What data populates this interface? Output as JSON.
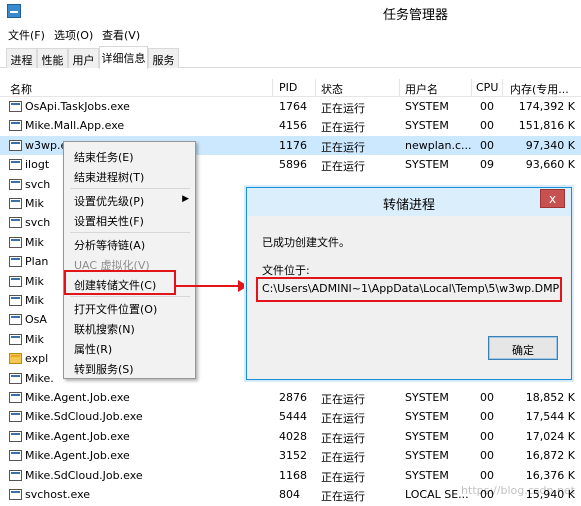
{
  "window": {
    "title": "任务管理器"
  },
  "menu": [
    "文件(F)",
    "选项(O)",
    "查看(V)"
  ],
  "tabs": [
    "进程",
    "性能",
    "用户",
    "详细信息",
    "服务"
  ],
  "columns": {
    "name": "名称",
    "pid": "PID",
    "status": "状态",
    "user": "用户名",
    "cpu": "CPU",
    "mem": "内存(专用..."
  },
  "rows": [
    {
      "name": "OsApi.TaskJobs.exe",
      "pid": "1764",
      "status": "正在运行",
      "user": "SYSTEM",
      "cpu": "00",
      "mem": "174,392 K"
    },
    {
      "name": "Mike.Mall.App.exe",
      "pid": "4156",
      "status": "正在运行",
      "user": "SYSTEM",
      "cpu": "00",
      "mem": "151,816 K"
    },
    {
      "name": "w3wp.exe",
      "pid": "1176",
      "status": "正在运行",
      "user": "newplan.c...",
      "cpu": "00",
      "mem": "97,340 K"
    },
    {
      "name": "ilogt",
      "pid": "5896",
      "status": "正在运行",
      "user": "SYSTEM",
      "cpu": "09",
      "mem": "93,660 K"
    },
    {
      "name": "svch",
      "pid": "",
      "status": "",
      "user": "",
      "cpu": "",
      "mem": ""
    },
    {
      "name": "Mik",
      "pid": "",
      "status": "",
      "user": "",
      "cpu": "",
      "mem": ""
    },
    {
      "name": "svch",
      "pid": "",
      "status": "",
      "user": "",
      "cpu": "",
      "mem": ""
    },
    {
      "name": "Mik",
      "pid": "",
      "status": "",
      "user": "",
      "cpu": "",
      "mem": ""
    },
    {
      "name": "Plan",
      "pid": "",
      "status": "",
      "user": "",
      "cpu": "",
      "mem": ""
    },
    {
      "name": "Mik",
      "pid": "",
      "status": "",
      "user": "",
      "cpu": "",
      "mem": ""
    },
    {
      "name": "Mik",
      "pid": "",
      "status": "",
      "user": "",
      "cpu": "",
      "mem": ""
    },
    {
      "name": "OsA",
      "pid": "",
      "status": "",
      "user": "",
      "cpu": "",
      "mem": ""
    },
    {
      "name": "Mik",
      "pid": "",
      "status": "",
      "user": "",
      "cpu": "",
      "mem": ""
    },
    {
      "name": "expl",
      "pid": "",
      "status": "",
      "user": "",
      "cpu": "",
      "mem": ""
    },
    {
      "name": "Mike.",
      "pid": "",
      "status": "",
      "user": "",
      "cpu": "",
      "mem": ""
    },
    {
      "name": "Mike.Agent.Job.exe",
      "pid": "2876",
      "status": "正在运行",
      "user": "SYSTEM",
      "cpu": "00",
      "mem": "18,852 K"
    },
    {
      "name": "Mike.SdCloud.Job.exe",
      "pid": "5444",
      "status": "正在运行",
      "user": "SYSTEM",
      "cpu": "00",
      "mem": "17,544 K"
    },
    {
      "name": "Mike.Agent.Job.exe",
      "pid": "4028",
      "status": "正在运行",
      "user": "SYSTEM",
      "cpu": "00",
      "mem": "17,024 K"
    },
    {
      "name": "Mike.Agent.Job.exe",
      "pid": "3152",
      "status": "正在运行",
      "user": "SYSTEM",
      "cpu": "00",
      "mem": "16,872 K"
    },
    {
      "name": "Mike.SdCloud.Job.exe",
      "pid": "1168",
      "status": "正在运行",
      "user": "SYSTEM",
      "cpu": "00",
      "mem": "16,376 K"
    },
    {
      "name": "svchost.exe",
      "pid": "804",
      "status": "正在运行",
      "user": "LOCAL SE...",
      "cpu": "00",
      "mem": "15,940 K"
    }
  ],
  "context_menu": {
    "items": [
      {
        "label": "结束任务(E)",
        "enabled": true
      },
      {
        "label": "结束进程树(T)",
        "enabled": true
      },
      {
        "label": "设置优先级(P)",
        "enabled": true,
        "submenu": true
      },
      {
        "label": "设置相关性(F)",
        "enabled": true
      },
      {
        "label": "分析等待链(A)",
        "enabled": true
      },
      {
        "label": "UAC 虚拟化(V)",
        "enabled": false
      },
      {
        "label": "创建转储文件(C)",
        "enabled": true
      },
      {
        "label": "打开文件位置(O)",
        "enabled": true
      },
      {
        "label": "联机搜索(N)",
        "enabled": true
      },
      {
        "label": "属性(R)",
        "enabled": true
      },
      {
        "label": "转到服务(S)",
        "enabled": true
      }
    ]
  },
  "dialog": {
    "title": "转储进程",
    "close_label": "x",
    "message": "已成功创建文件。",
    "location_label": "文件位于:",
    "path": "C:\\Users\\ADMINI~1\\AppData\\Local\\Temp\\5\\w3wp.DMP",
    "ok_label": "确定"
  },
  "watermark": "https://blog.csdn.net",
  "colors": {
    "selected_row": "#cce8ff",
    "highlight": "#e2141a",
    "dialog_border": "#1c8fd8"
  }
}
